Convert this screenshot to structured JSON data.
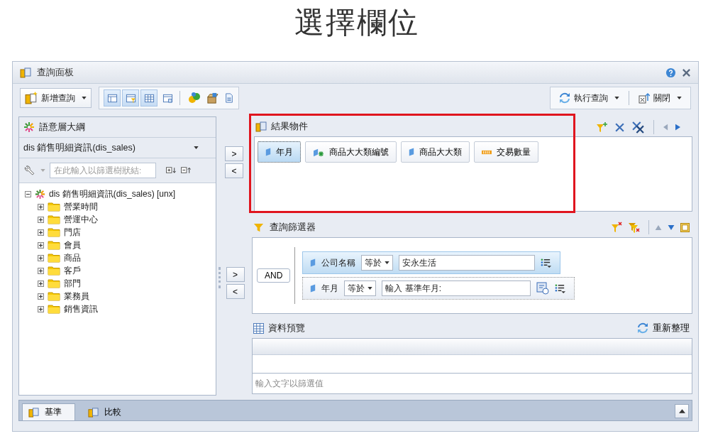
{
  "page_title": "選擇欄位",
  "window": {
    "title": "查詢面板"
  },
  "toolbar": {
    "new_query": "新增查詢",
    "view_toggles": [
      {
        "selected": true
      },
      {
        "selected": true
      },
      {
        "selected": true
      },
      {
        "selected": false
      }
    ],
    "run_query": "執行查詢",
    "close": "關閉"
  },
  "outline": {
    "title": "語意層大綱",
    "universe": "dis 銷售明細資訊(dis_sales)",
    "search_placeholder": "在此輸入以篩選樹狀結:",
    "tree": [
      {
        "label": "dis 銷售明細資訊(dis_sales) [unx]",
        "expanded": true,
        "children": [
          {
            "label": "營業時間",
            "expanded": false
          },
          {
            "label": "營運中心",
            "expanded": false
          },
          {
            "label": "門店",
            "expanded": false
          },
          {
            "label": "會員",
            "expanded": false
          },
          {
            "label": "商品",
            "expanded": false
          },
          {
            "label": "客戶",
            "expanded": false
          },
          {
            "label": "部門",
            "expanded": false
          },
          {
            "label": "業務員",
            "expanded": false
          },
          {
            "label": "銷售資訊",
            "expanded": false
          }
        ]
      }
    ]
  },
  "result_transfer": [
    ">",
    "<"
  ],
  "filter_transfer": [
    ">",
    "<"
  ],
  "result_objects": {
    "title": "結果物件",
    "highlighted": true,
    "items": [
      {
        "label": "年月",
        "kind": "dimension",
        "selected": true
      },
      {
        "label": "商品大大類編號",
        "kind": "attribute",
        "selected": false
      },
      {
        "label": "商品大大類",
        "kind": "dimension",
        "selected": false
      },
      {
        "label": "交易數量",
        "kind": "measure",
        "selected": false
      }
    ]
  },
  "query_filters": {
    "title": "查詢篩選器",
    "operator": "AND",
    "filters": [
      {
        "object": "公司名稱",
        "operator": "等於",
        "value": "安永生活",
        "kind": "constant",
        "selected": true
      },
      {
        "object": "年月",
        "operator": "等於",
        "value": "輸入 基準年月:",
        "kind": "prompt",
        "selected": false
      }
    ]
  },
  "data_preview": {
    "title": "資料預覽",
    "refresh": "重新整理",
    "filter_placeholder": "輸入文字以篩選值"
  },
  "bottom_tabs": [
    {
      "label": "基準",
      "selected": true
    },
    {
      "label": "比較",
      "selected": false
    }
  ]
}
